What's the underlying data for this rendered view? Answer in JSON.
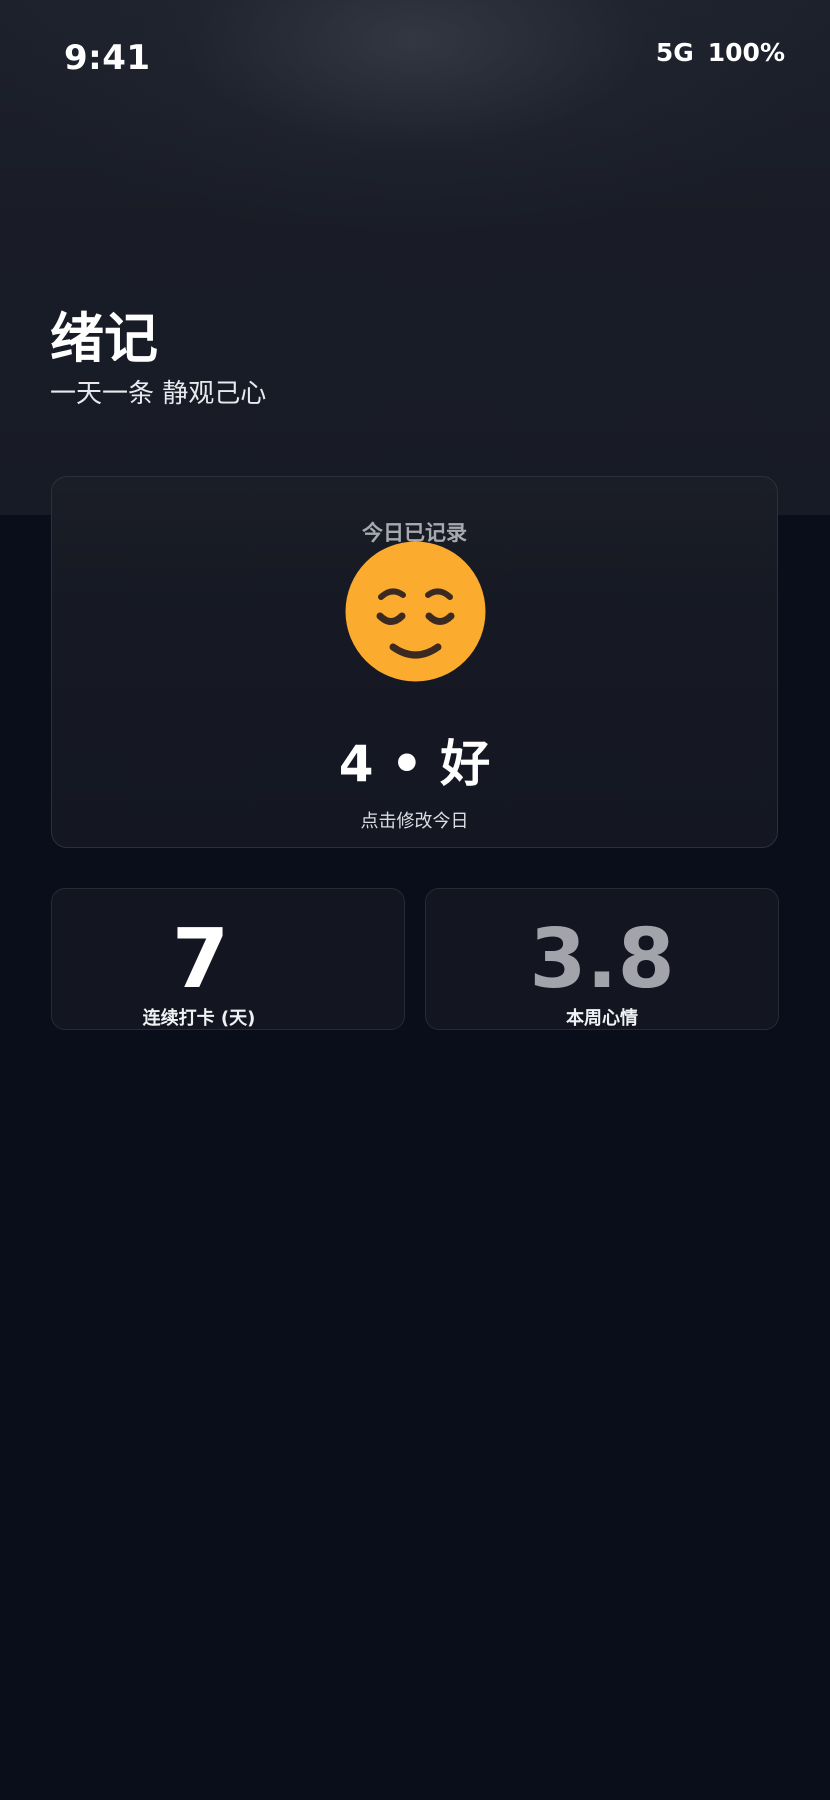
{
  "status_bar": {
    "time": "9:41",
    "network": "5G",
    "battery": "100%"
  },
  "header": {
    "title": "绪记",
    "subtitle": "一天一条 静观己心"
  },
  "today_card": {
    "label": "今日已记录",
    "mood_icon": "relieved-face-icon",
    "mood_score": "4 • 好",
    "edit_link": "点击修改今日"
  },
  "stats": [
    {
      "value": "7",
      "label": "连续打卡 (天)"
    },
    {
      "value": "3.8",
      "label": "本周心情"
    }
  ],
  "colors": {
    "background": "#0a0e1a",
    "card": "#141722",
    "emoji_face": "#fbab2e",
    "muted_value": "#a3a4ab"
  }
}
